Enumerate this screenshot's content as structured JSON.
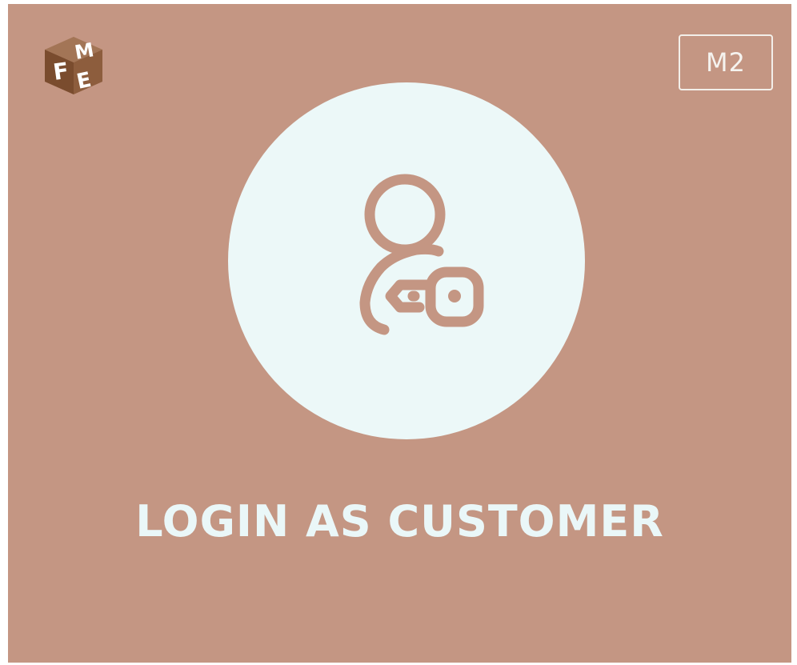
{
  "brand": {
    "logo_letters": [
      "F",
      "M",
      "E"
    ],
    "colors": {
      "background": "#c49683",
      "circle": "#ecf8f8",
      "icon_stroke": "#c49683",
      "title": "#eaf7f8",
      "logo_wood": "#8a5a3a"
    },
    "logo_icon": "fme-cube-logo"
  },
  "badge": {
    "label": "M2"
  },
  "hero": {
    "icon": "user-key-icon",
    "title": "LOGIN AS CUSTOMER"
  }
}
